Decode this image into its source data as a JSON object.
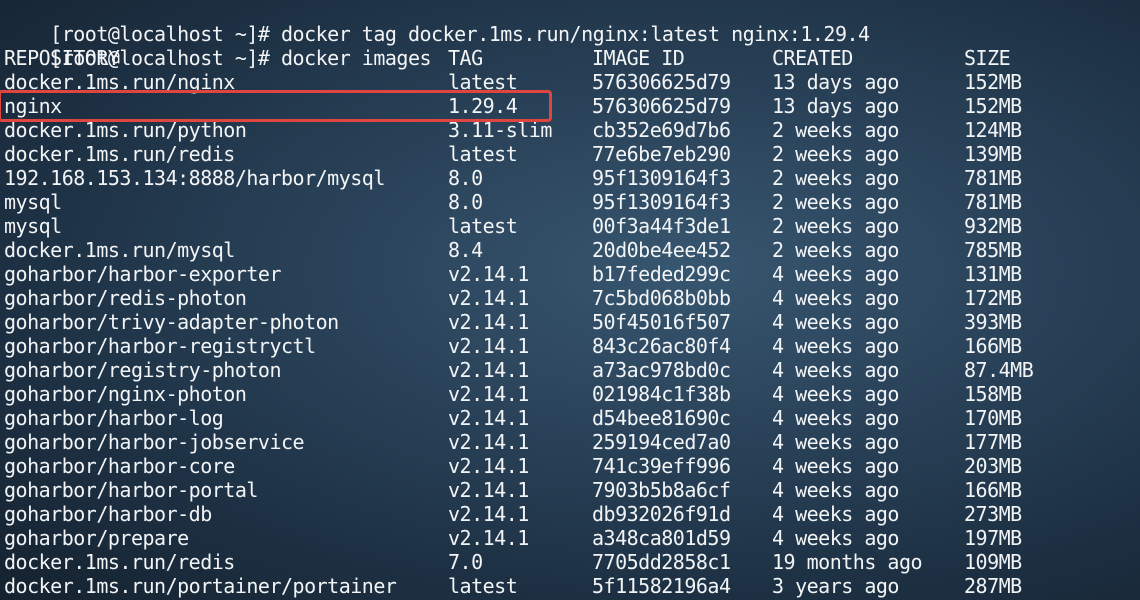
{
  "terminal": {
    "commands": [
      {
        "prompt": "[root@localhost ~]# ",
        "command": "docker tag docker.1ms.run/nginx:latest nginx:1.29.4"
      },
      {
        "prompt": "[root@localhost ~]# ",
        "command": "docker images"
      }
    ],
    "headers": {
      "repository": "REPOSITORY",
      "tag": "TAG",
      "image_id": "IMAGE ID",
      "created": "CREATED",
      "size": "SIZE"
    },
    "rows": [
      {
        "repository": "docker.1ms.run/nginx",
        "tag": "latest",
        "image_id": "576306625d79",
        "created": "13 days ago",
        "size": "152MB"
      },
      {
        "repository": "nginx",
        "tag": "1.29.4",
        "image_id": "576306625d79",
        "created": "13 days ago",
        "size": "152MB"
      },
      {
        "repository": "docker.1ms.run/python",
        "tag": "3.11-slim",
        "image_id": "cb352e69d7b6",
        "created": "2 weeks ago",
        "size": "124MB"
      },
      {
        "repository": "docker.1ms.run/redis",
        "tag": "latest",
        "image_id": "77e6be7eb290",
        "created": "2 weeks ago",
        "size": "139MB"
      },
      {
        "repository": "192.168.153.134:8888/harbor/mysql",
        "tag": "8.0",
        "image_id": "95f1309164f3",
        "created": "2 weeks ago",
        "size": "781MB"
      },
      {
        "repository": "mysql",
        "tag": "8.0",
        "image_id": "95f1309164f3",
        "created": "2 weeks ago",
        "size": "781MB"
      },
      {
        "repository": "mysql",
        "tag": "latest",
        "image_id": "00f3a44f3de1",
        "created": "2 weeks ago",
        "size": "932MB"
      },
      {
        "repository": "docker.1ms.run/mysql",
        "tag": "8.4",
        "image_id": "20d0be4ee452",
        "created": "2 weeks ago",
        "size": "785MB"
      },
      {
        "repository": "goharbor/harbor-exporter",
        "tag": "v2.14.1",
        "image_id": "b17feded299c",
        "created": "4 weeks ago",
        "size": "131MB"
      },
      {
        "repository": "goharbor/redis-photon",
        "tag": "v2.14.1",
        "image_id": "7c5bd068b0bb",
        "created": "4 weeks ago",
        "size": "172MB"
      },
      {
        "repository": "goharbor/trivy-adapter-photon",
        "tag": "v2.14.1",
        "image_id": "50f45016f507",
        "created": "4 weeks ago",
        "size": "393MB"
      },
      {
        "repository": "goharbor/harbor-registryctl",
        "tag": "v2.14.1",
        "image_id": "843c26ac80f4",
        "created": "4 weeks ago",
        "size": "166MB"
      },
      {
        "repository": "goharbor/registry-photon",
        "tag": "v2.14.1",
        "image_id": "a73ac978bd0c",
        "created": "4 weeks ago",
        "size": "87.4MB"
      },
      {
        "repository": "goharbor/nginx-photon",
        "tag": "v2.14.1",
        "image_id": "021984c1f38b",
        "created": "4 weeks ago",
        "size": "158MB"
      },
      {
        "repository": "goharbor/harbor-log",
        "tag": "v2.14.1",
        "image_id": "d54bee81690c",
        "created": "4 weeks ago",
        "size": "170MB"
      },
      {
        "repository": "goharbor/harbor-jobservice",
        "tag": "v2.14.1",
        "image_id": "259194ced7a0",
        "created": "4 weeks ago",
        "size": "177MB"
      },
      {
        "repository": "goharbor/harbor-core",
        "tag": "v2.14.1",
        "image_id": "741c39eff996",
        "created": "4 weeks ago",
        "size": "203MB"
      },
      {
        "repository": "goharbor/harbor-portal",
        "tag": "v2.14.1",
        "image_id": "7903b5b8a6cf",
        "created": "4 weeks ago",
        "size": "166MB"
      },
      {
        "repository": "goharbor/harbor-db",
        "tag": "v2.14.1",
        "image_id": "db932026f91d",
        "created": "4 weeks ago",
        "size": "273MB"
      },
      {
        "repository": "goharbor/prepare",
        "tag": "v2.14.1",
        "image_id": "a348ca801d59",
        "created": "4 weeks ago",
        "size": "197MB"
      },
      {
        "repository": "docker.1ms.run/redis",
        "tag": "7.0",
        "image_id": "7705dd2858c1",
        "created": "19 months ago",
        "size": "109MB"
      },
      {
        "repository": "docker.1ms.run/portainer/portainer",
        "tag": "latest",
        "image_id": "5f11582196a4",
        "created": "3 years ago",
        "size": "287MB"
      }
    ],
    "highlight_color": "#e0463f"
  }
}
